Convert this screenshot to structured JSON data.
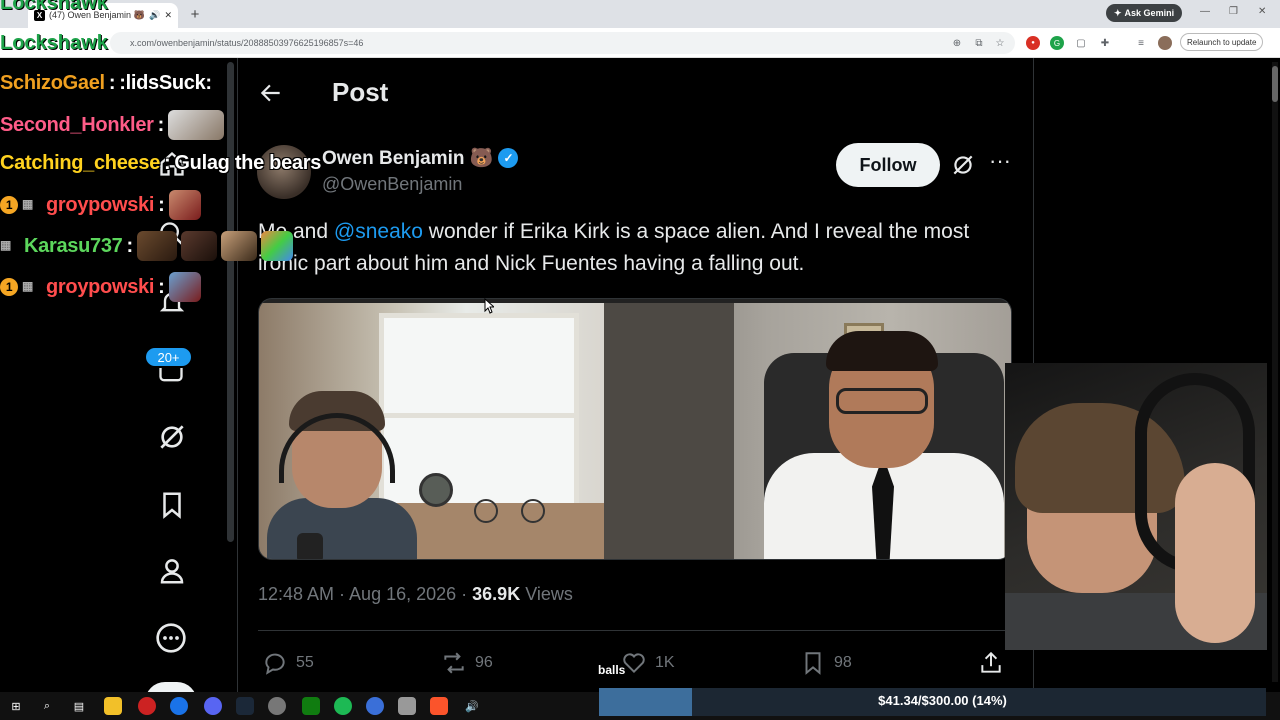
{
  "browser": {
    "tab_title": "(47) Owen Benjamin 🐻 on X",
    "url": "x.com/owenbenjamin/status/20888503976625196857s=46",
    "ask_gemini": "Ask Gemini",
    "relaunch": "Relaunch to update",
    "new_tab": "+"
  },
  "overlay": {
    "brand": "Lockshawk",
    "chat": [
      {
        "user": "SchizoGael",
        "message": ":lidsSuck:",
        "color": "#f0a020"
      },
      {
        "user": "Second_Honkler",
        "message": "",
        "color": "#ff5c88"
      },
      {
        "user": "Catching_cheese",
        "message": "Gulag the bears",
        "color": "#ffd21f"
      },
      {
        "user": "groypowski",
        "message": "",
        "color": "#ff4d4d"
      },
      {
        "user": "Karasu737",
        "message": "",
        "color": "#5cd65c"
      },
      {
        "user": "groypowski",
        "message": "",
        "color": "#ff4d4d"
      }
    ],
    "balls_label": "balls",
    "donation": "$41.34/$300.00 (14%)",
    "donation_progress": 0.14
  },
  "sidebar": {
    "badge": "20+"
  },
  "post": {
    "header": "Post",
    "author_name": "Owen Benjamin 🐻",
    "author_handle": "@OwenBenjamin",
    "follow_label": "Follow",
    "text_before": "Me and ",
    "mention": "@sneako",
    "text_after": " wonder if Erika Kirk is a space alien. And I reveal the most ironic part about him and Nick Fuentes having a falling out.",
    "time": "12:48 AM · Aug 16, 2026 · ",
    "views_count": "36.9K",
    "views_label": " Views",
    "replies": "55",
    "reposts": "96",
    "likes": "1K",
    "bookmarks": "98"
  },
  "icons": [
    "back-arrow-icon",
    "grok-icon",
    "more-icon",
    "home-icon",
    "search-icon",
    "notifications-icon",
    "messages-icon",
    "bookmark-icon",
    "profile-icon",
    "more-circle-icon",
    "reply-icon",
    "repost-icon",
    "like-icon",
    "share-icon"
  ]
}
